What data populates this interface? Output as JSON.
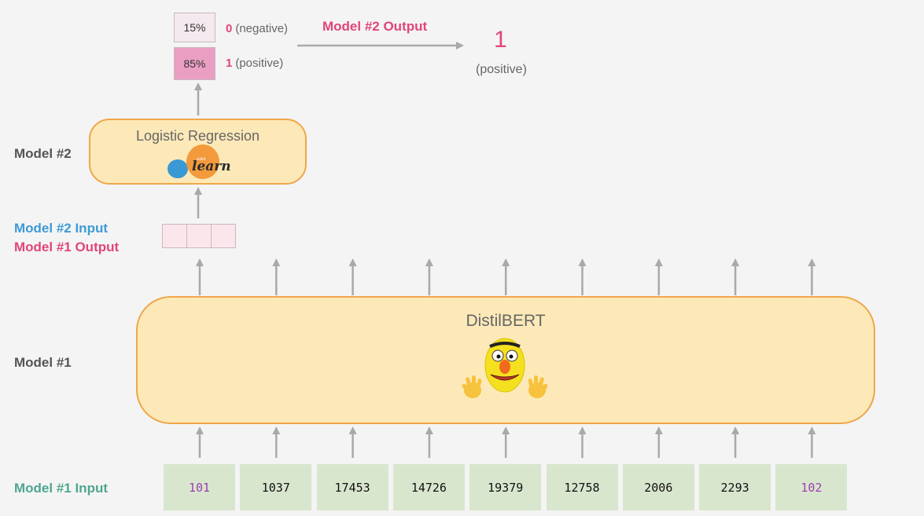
{
  "output_probs": [
    {
      "percent": "15%",
      "num": "0",
      "label": "(negative)",
      "color": "#f4e9ee"
    },
    {
      "percent": "85%",
      "num": "1",
      "label": "(positive)",
      "color": "#ea9fc2"
    }
  ],
  "model2_output": {
    "label": "Model #2 Output",
    "value": "1",
    "sublabel": "(positive)"
  },
  "model2": {
    "label": "Model #2",
    "title": "Logistic Regression",
    "logo_text": "learn",
    "logo_small": "scikit"
  },
  "mid_labels": {
    "model2_input": "Model #2 Input",
    "model1_output": "Model #1 Output"
  },
  "model1": {
    "label": "Model #1",
    "title": "DistilBERT",
    "mascot_icon": "bert-muppet-icon",
    "hands_icon": "waving-hands-icon"
  },
  "input": {
    "label": "Model #1 Input",
    "tokens": [
      {
        "value": "101",
        "special": true
      },
      {
        "value": "1037",
        "special": false
      },
      {
        "value": "17453",
        "special": false
      },
      {
        "value": "14726",
        "special": false
      },
      {
        "value": "19379",
        "special": false
      },
      {
        "value": "12758",
        "special": false
      },
      {
        "value": "2006",
        "special": false
      },
      {
        "value": "2293",
        "special": false
      },
      {
        "value": "102",
        "special": true
      }
    ]
  },
  "colors": {
    "box_fill": "#fde9b8",
    "box_border": "#f0a64a",
    "token_fill": "#d9e6ce",
    "pink": "#e0457b",
    "blue": "#3d9bd6",
    "teal": "#4fa68f"
  }
}
